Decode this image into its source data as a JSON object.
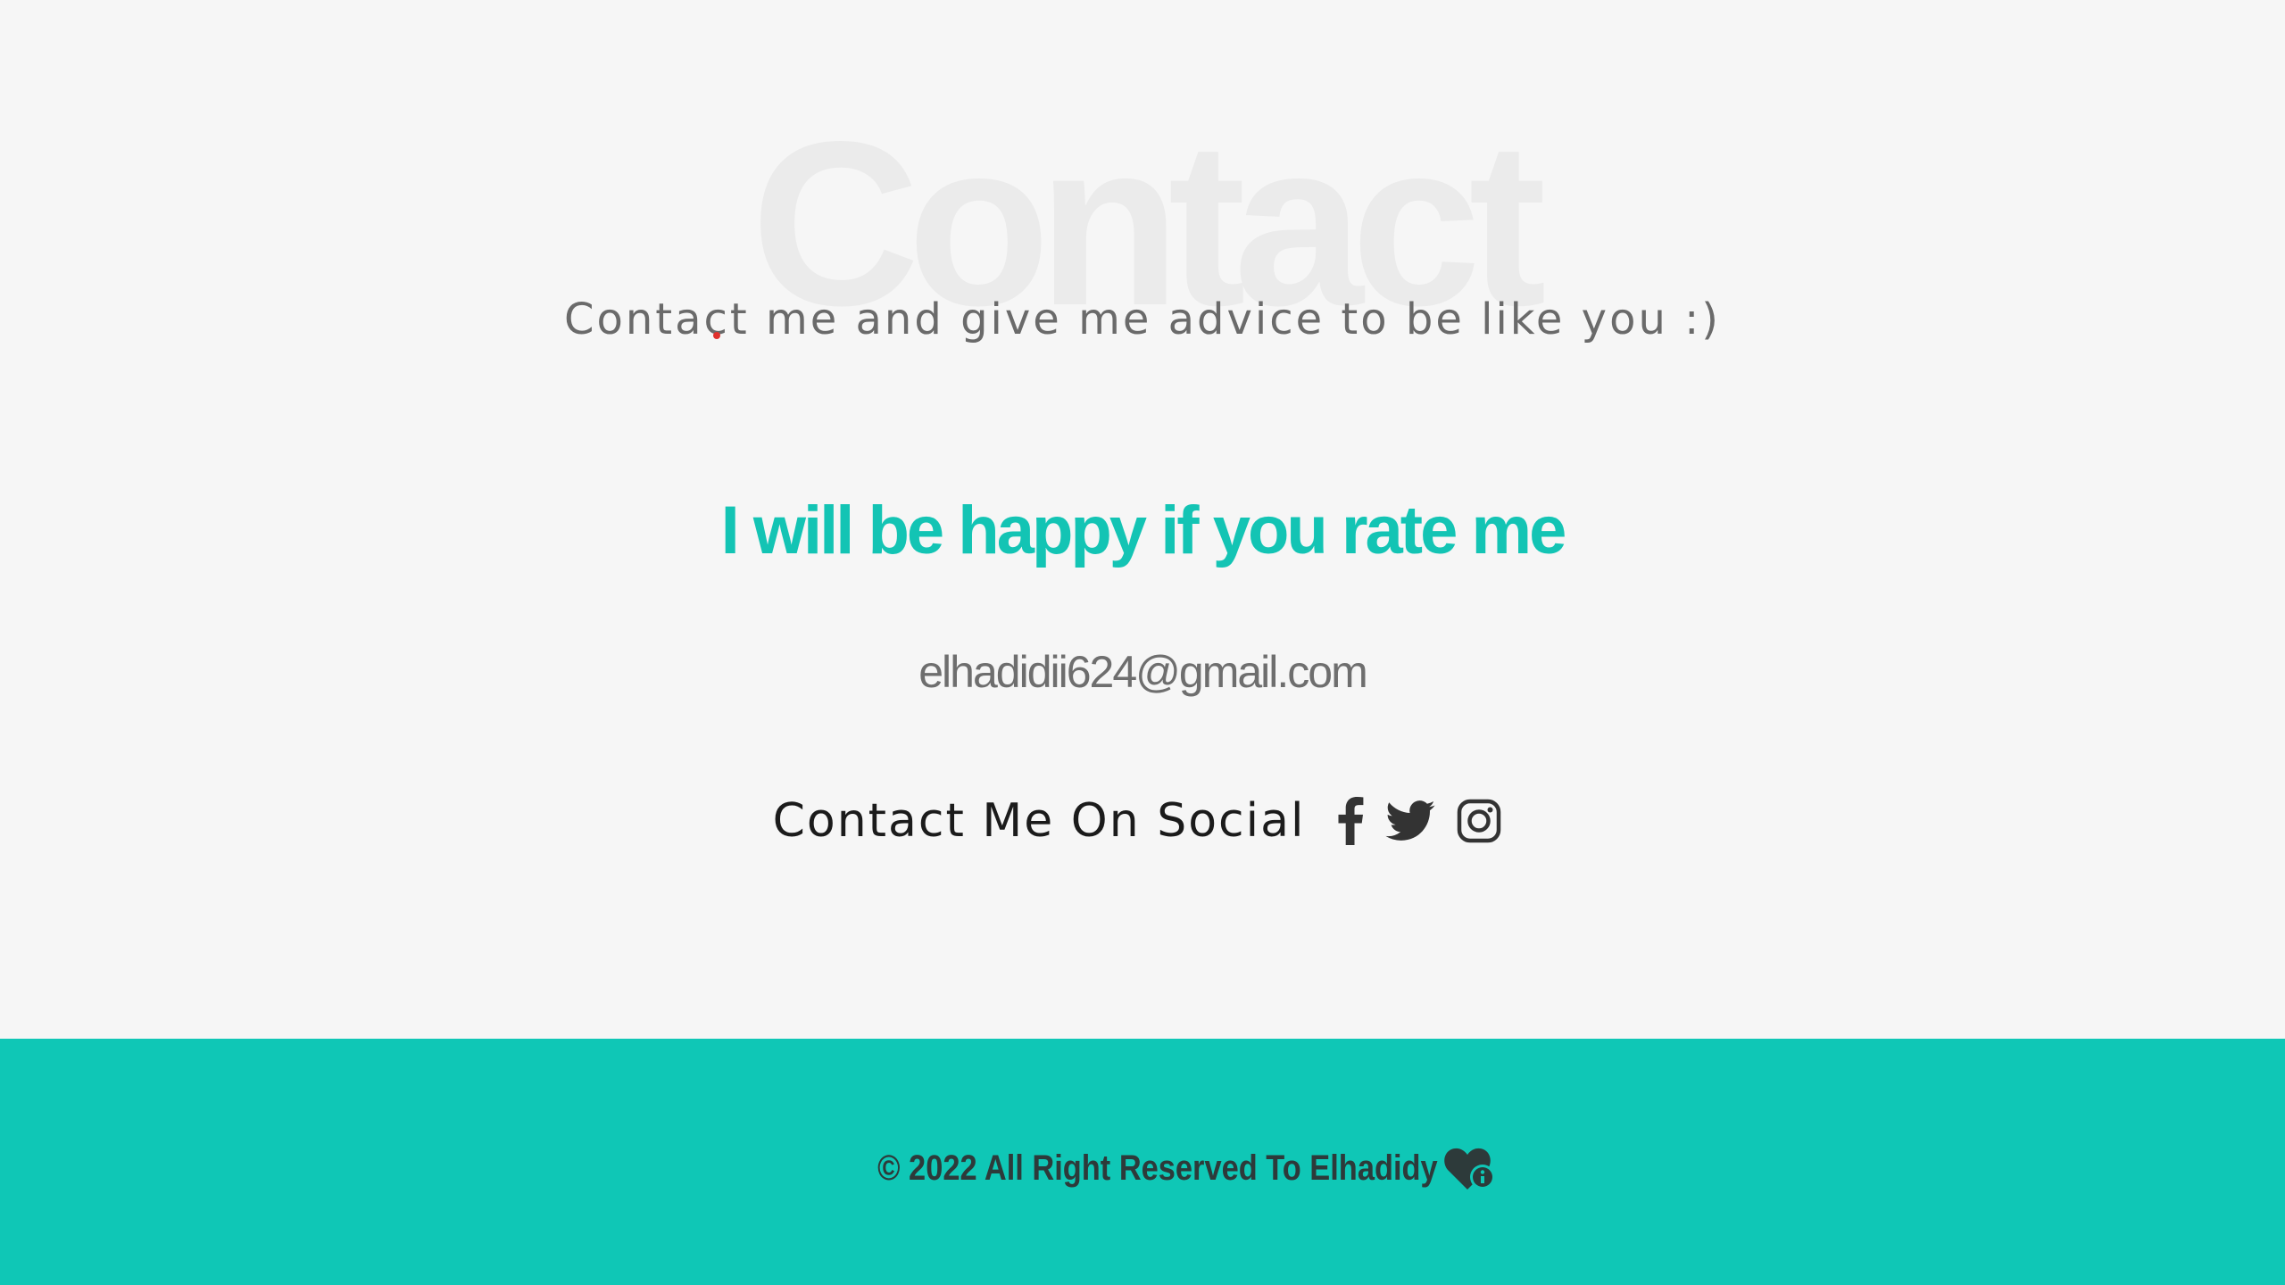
{
  "contact": {
    "bg_title": "Contact",
    "subtitle": "Contact me and give me advice to be like you :)",
    "rate_heading": "I will be happy if you rate me",
    "email": "elhadidii624@gmail.com",
    "social_label": "Contact Me On Social",
    "social_icons": [
      "facebook-icon",
      "twitter-icon",
      "instagram-icon"
    ]
  },
  "footer": {
    "text": "© 2022 All Right Reserved To Elhadidy",
    "icon": "heart-icon"
  },
  "colors": {
    "accent": "#13c4b4",
    "footer_bg": "#0fc7b6",
    "page_bg": "#f6f6f6",
    "icon_dark": "#333333"
  }
}
